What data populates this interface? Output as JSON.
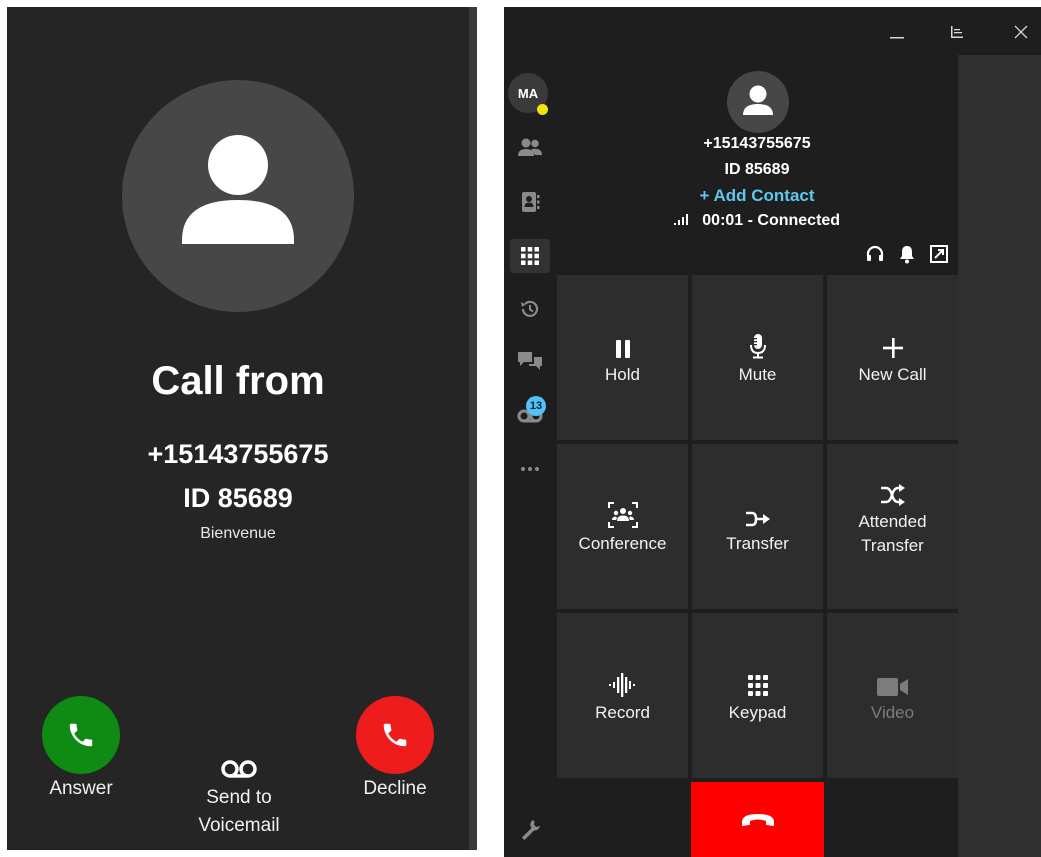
{
  "incoming": {
    "title": "Call from",
    "number": "+15143755675",
    "id": "ID 85689",
    "subtitle": "Bienvenue",
    "answer_label": "Answer",
    "voicemail_label": "Send to\nVoicemail",
    "decline_label": "Decline",
    "colors": {
      "answer": "#0f8a12",
      "decline": "#ee1c1c"
    }
  },
  "softphone": {
    "user_initials": "MA",
    "presence_color": "#f4e30b",
    "voicemail_badge": "13",
    "sidebar_icons": [
      "contacts-icon",
      "address-book-icon",
      "dialpad-icon",
      "history-icon",
      "chat-icon",
      "voicemail-icon",
      "more-icon",
      "settings-wrench-icon"
    ],
    "call": {
      "number": "+15143755675",
      "id": "ID 85689",
      "add_contact": "+ Add Contact",
      "status": "00:01 - Connected"
    },
    "actions": {
      "hold": "Hold",
      "mute": "Mute",
      "new_call": "New Call",
      "conference": "Conference",
      "transfer": "Transfer",
      "attended_transfer": "Attended\nTransfer",
      "record": "Record",
      "keypad": "Keypad",
      "video": "Video"
    },
    "accent_color": "#5cc8f0",
    "hangup_color": "#ff0000"
  }
}
